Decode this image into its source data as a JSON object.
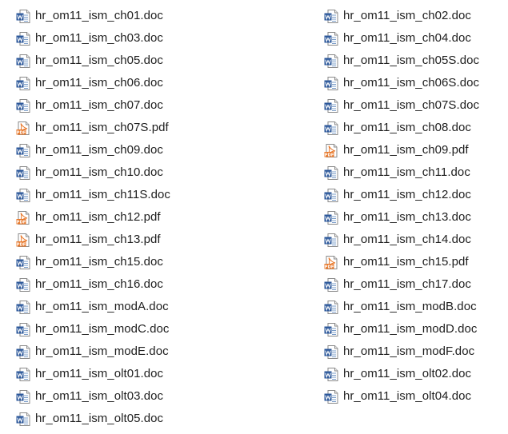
{
  "colors": {
    "text": "#1e1e1e",
    "word_icon": "#2b579a",
    "pdf_icon": "#e8792c"
  },
  "files": {
    "left": [
      {
        "name": "hr_om11_ism_ch01.doc",
        "icon": "word-doc-icon"
      },
      {
        "name": "hr_om11_ism_ch03.doc",
        "icon": "word-doc-icon"
      },
      {
        "name": "hr_om11_ism_ch05.doc",
        "icon": "word-doc-icon"
      },
      {
        "name": "hr_om11_ism_ch06.doc",
        "icon": "word-doc-icon"
      },
      {
        "name": "hr_om11_ism_ch07.doc",
        "icon": "word-doc-icon"
      },
      {
        "name": "hr_om11_ism_ch07S.pdf",
        "icon": "pdf-doc-icon"
      },
      {
        "name": "hr_om11_ism_ch09.doc",
        "icon": "word-doc-icon"
      },
      {
        "name": "hr_om11_ism_ch10.doc",
        "icon": "word-doc-icon"
      },
      {
        "name": "hr_om11_ism_ch11S.doc",
        "icon": "word-doc-icon"
      },
      {
        "name": "hr_om11_ism_ch12.pdf",
        "icon": "pdf-doc-icon"
      },
      {
        "name": "hr_om11_ism_ch13.pdf",
        "icon": "pdf-doc-icon"
      },
      {
        "name": "hr_om11_ism_ch15.doc",
        "icon": "word-doc-icon"
      },
      {
        "name": "hr_om11_ism_ch16.doc",
        "icon": "word-doc-icon"
      },
      {
        "name": "hr_om11_ism_modA.doc",
        "icon": "word-doc-icon"
      },
      {
        "name": "hr_om11_ism_modC.doc",
        "icon": "word-doc-icon"
      },
      {
        "name": "hr_om11_ism_modE.doc",
        "icon": "word-doc-icon"
      },
      {
        "name": "hr_om11_ism_olt01.doc",
        "icon": "word-doc-icon"
      },
      {
        "name": "hr_om11_ism_olt03.doc",
        "icon": "word-doc-icon"
      },
      {
        "name": "hr_om11_ism_olt05.doc",
        "icon": "word-doc-icon"
      }
    ],
    "right": [
      {
        "name": "hr_om11_ism_ch02.doc",
        "icon": "word-doc-icon"
      },
      {
        "name": "hr_om11_ism_ch04.doc",
        "icon": "word-doc-icon"
      },
      {
        "name": "hr_om11_ism_ch05S.doc",
        "icon": "word-doc-icon"
      },
      {
        "name": "hr_om11_ism_ch06S.doc",
        "icon": "word-doc-icon"
      },
      {
        "name": "hr_om11_ism_ch07S.doc",
        "icon": "word-doc-icon"
      },
      {
        "name": "hr_om11_ism_ch08.doc",
        "icon": "word-doc-icon"
      },
      {
        "name": "hr_om11_ism_ch09.pdf",
        "icon": "pdf-doc-icon"
      },
      {
        "name": "hr_om11_ism_ch11.doc",
        "icon": "word-doc-icon"
      },
      {
        "name": "hr_om11_ism_ch12.doc",
        "icon": "word-doc-icon"
      },
      {
        "name": "hr_om11_ism_ch13.doc",
        "icon": "word-doc-icon"
      },
      {
        "name": "hr_om11_ism_ch14.doc",
        "icon": "word-doc-icon"
      },
      {
        "name": "hr_om11_ism_ch15.pdf",
        "icon": "pdf-doc-icon"
      },
      {
        "name": "hr_om11_ism_ch17.doc",
        "icon": "word-doc-icon"
      },
      {
        "name": "hr_om11_ism_modB.doc",
        "icon": "word-doc-icon"
      },
      {
        "name": "hr_om11_ism_modD.doc",
        "icon": "word-doc-icon"
      },
      {
        "name": "hr_om11_ism_modF.doc",
        "icon": "word-doc-icon"
      },
      {
        "name": "hr_om11_ism_olt02.doc",
        "icon": "word-doc-icon"
      },
      {
        "name": "hr_om11_ism_olt04.doc",
        "icon": "word-doc-icon"
      }
    ]
  }
}
